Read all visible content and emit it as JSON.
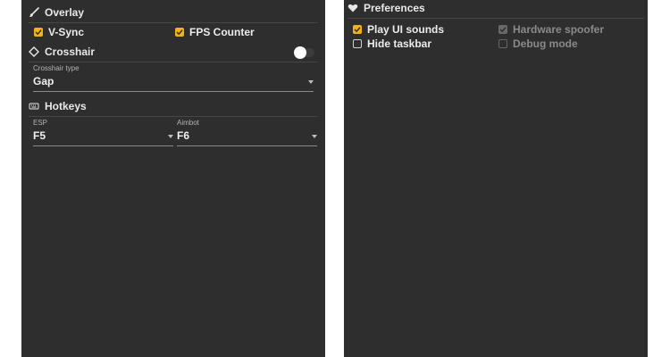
{
  "left_panel": {
    "overlay": {
      "title": "Overlay",
      "icon": "brush-icon",
      "vsync": {
        "label": "V-Sync",
        "checked": true
      },
      "fps_counter": {
        "label": "FPS Counter",
        "checked": true
      }
    },
    "crosshair": {
      "title": "Crosshair",
      "icon": "diamond-icon",
      "toggle_on": false,
      "type_dropdown": {
        "label": "Crosshair type",
        "value": "Gap"
      }
    },
    "hotkeys": {
      "title": "Hotkeys",
      "icon": "keyboard-icon",
      "esp": {
        "label": "ESP",
        "value": "F5"
      },
      "aimbot": {
        "label": "Aimbot",
        "value": "F6"
      }
    }
  },
  "right_panel": {
    "preferences": {
      "title": "Preferences",
      "icon": "heart-icon",
      "play_ui_sounds": {
        "label": "Play UI sounds",
        "checked": true
      },
      "hide_taskbar": {
        "label": "Hide taskbar",
        "checked": false
      },
      "hardware_spoofer": {
        "label": "Hardware spoofer",
        "checked": true,
        "disabled": true
      },
      "debug_mode": {
        "label": "Debug mode",
        "checked": false,
        "disabled": true
      }
    }
  },
  "colors": {
    "panel_bg": "#2e2e2e",
    "accent": "#f2b21c",
    "text": "#e6e6e6",
    "disabled_text": "#8a8a8a"
  }
}
